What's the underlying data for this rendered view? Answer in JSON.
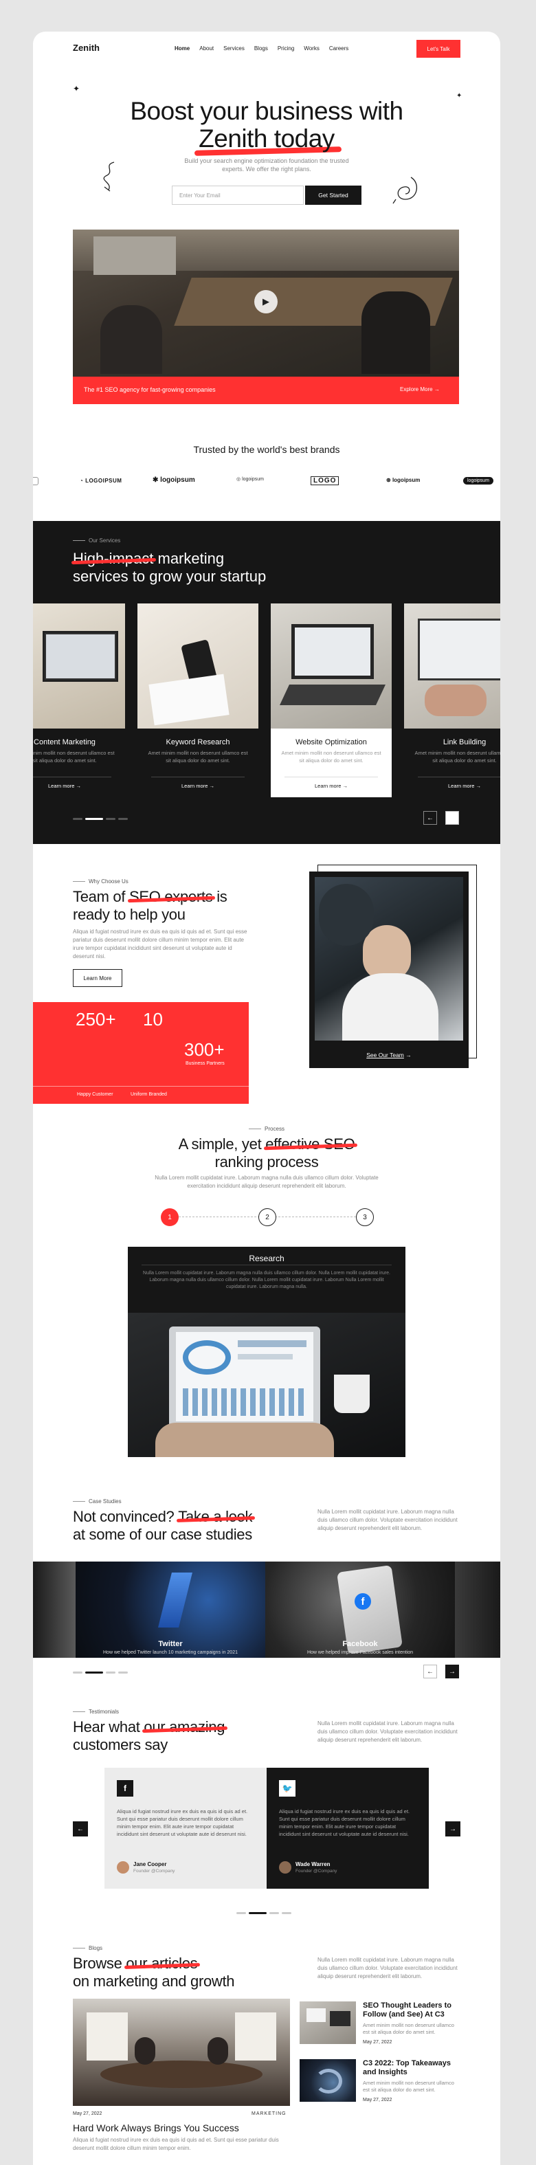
{
  "nav": {
    "brand": "Zenith",
    "links": [
      "Home",
      "About",
      "Services",
      "Blogs",
      "Pricing",
      "Works",
      "Careers"
    ],
    "cta": "Let's Talk"
  },
  "hero": {
    "title_line1": "Boost your business with",
    "title_line2": "Zenith today",
    "subtitle": "Build your search engine optimization foundation the trusted experts. We offer the right plans.",
    "email_placeholder": "Enter Your Email",
    "button": "Get Started",
    "banner_text": "The #1 SEO agency for fast-growing companies",
    "banner_link": "Explore More"
  },
  "brands": {
    "title": "Trusted by the world's best brands",
    "logos": [
      "LOGOIPSUM",
      "logoipsum",
      "logoipsum",
      "LOGO",
      "logoipsum",
      "logoipsum"
    ]
  },
  "services": {
    "eyebrow": "Our Services",
    "title_strike": "High-impact",
    "title_rest1": " marketing",
    "title_line2": "services to grow your startup",
    "cards": [
      {
        "title": "Content Marketing",
        "desc": "Amet minim mollit non deserunt ullamco est sit aliqua dolor do amet sint.",
        "link": "Learn more"
      },
      {
        "title": "Keyword Research",
        "desc": "Amet minim mollit non deserunt ullamco est sit aliqua dolor do amet sint.",
        "link": "Learn more"
      },
      {
        "title": "Website Optimization",
        "desc": "Amet minim mollit non deserunt ullamco est sit aliqua dolor do amet sint.",
        "link": "Learn more"
      },
      {
        "title": "Link Building",
        "desc": "Amet minim mollit non deserunt ullamco est sit aliqua dolor do amet sint.",
        "link": "Learn more"
      }
    ]
  },
  "why": {
    "eyebrow": "Why Choose Us",
    "title_a": "Team of ",
    "title_strike": "SEO experts",
    "title_b": " is",
    "title_line2": "ready to help you",
    "desc": "Aliqua id fugiat nostrud irure ex duis ea quis id quis ad et. Sunt qui esse pariatur duis deserunt mollit dolore cillum minim tempor enim. Elit aute irure tempor cupidatat incididunt sint deserunt ut voluptate aute id deserunt nisi.",
    "button": "Learn More",
    "stat1": "250+",
    "stat2": "10",
    "stat3": "300+",
    "stat3_label": "Business Partners",
    "label1": "Happy Customer",
    "label2": "Uniform Branded",
    "team_link": "See Our Team"
  },
  "process": {
    "eyebrow": "Process",
    "title_a": "A simple, yet ",
    "title_strike": "effective SEO",
    "title_line2": "ranking process",
    "desc": "Nulla Lorem mollit cupidatat irure. Laborum magna nulla duis ullamco cillum dolor. Voluptate exercitation incididunt aliquip deserunt reprehenderit elit laborum.",
    "steps": [
      "1",
      "2",
      "3"
    ],
    "card_title": "Research",
    "card_desc": "Nulla Lorem mollit cupidatat irure. Laborum magna nulla duis ullamco cillum dolor. Nulla Lorem mollit cupidatat irure. Laborum magna nulla duis ullamco cillum dolor. Nulla Lorem mollit cupidatat irure. Laborum Nulla Lorem mollit cupidatat irure. Laborum magna nulla."
  },
  "cases": {
    "eyebrow": "Case Studies",
    "title_a": "Not convinced? ",
    "title_strike": "Take a look",
    "title_line2": "at some of our case studies",
    "desc": "Nulla Lorem mollit cupidatat irure. Laborum magna nulla duis ullamco cillum dolor. Voluptate exercitation incididunt aliquip deserunt reprehenderit elit laborum.",
    "items": [
      {
        "title": "Twitter",
        "desc": "How we helped Twitter launch 10 marketing campaigns in 2021"
      },
      {
        "title": "Facebook",
        "desc": "How we helped improve Facebook sales intention"
      }
    ]
  },
  "testimonials": {
    "eyebrow": "Testimonials",
    "title_a": "Hear what ",
    "title_strike": "our amazing",
    "title_line2": "customers say",
    "desc": "Nulla Lorem mollit cupidatat irure. Laborum magna nulla duis ullamco cillum dolor. Voluptate exercitation incididunt aliquip deserunt reprehenderit elit laborum.",
    "items": [
      {
        "quote": "Aliqua id fugiat nostrud irure ex duis ea quis id quis ad et. Sunt qui esse pariatur duis deserunt mollit dolore cillum minim tempor enim. Elit aute irure tempor cupidatat incididunt sint deserunt ut voluptate aute id deserunt nisi.",
        "name": "Jane Cooper",
        "role": "Founder @Company"
      },
      {
        "quote": "Aliqua id fugiat nostrud irure ex duis ea quis id quis ad et. Sunt qui esse pariatur duis deserunt mollit dolore cillum minim tempor enim. Elit aute irure tempor cupidatat incididunt sint deserunt ut voluptate aute id deserunt nisi.",
        "name": "Wade Warren",
        "role": "Founder @Company"
      }
    ]
  },
  "blogs": {
    "eyebrow": "Blogs",
    "title_a": "Browse ",
    "title_strike": "our articles",
    "title_line2": "on marketing and growth",
    "desc": "Nulla Lorem mollit cupidatat irure. Laborum magna nulla duis ullamco cillum dolor. Voluptate exercitation incididunt aliquip deserunt reprehenderit elit laborum.",
    "main": {
      "date": "May 27, 2022",
      "category": "MARKETING",
      "title": "Hard Work Always Brings You Success",
      "desc": "Aliqua id fugiat nostrud irure ex duis ea quis id quis ad et. Sunt qui esse pariatur duis deserunt mollit dolore cillum minim tempor enim."
    },
    "side": [
      {
        "title": "SEO Thought Leaders to Follow (and See) At C3",
        "desc": "Amet minim mollit non deserunt ullamco est sit aliqua dolor do amet sint.",
        "date": "May 27, 2022"
      },
      {
        "title": "C3 2022: Top Takeaways and Insights",
        "desc": "Amet minim mollit non deserunt ullamco est sit aliqua dolor do amet sint.",
        "date": "May 27, 2022"
      }
    ]
  },
  "colors": {
    "accent": "#ff3131",
    "dark": "#161616",
    "bg": "#e6e6e6"
  }
}
